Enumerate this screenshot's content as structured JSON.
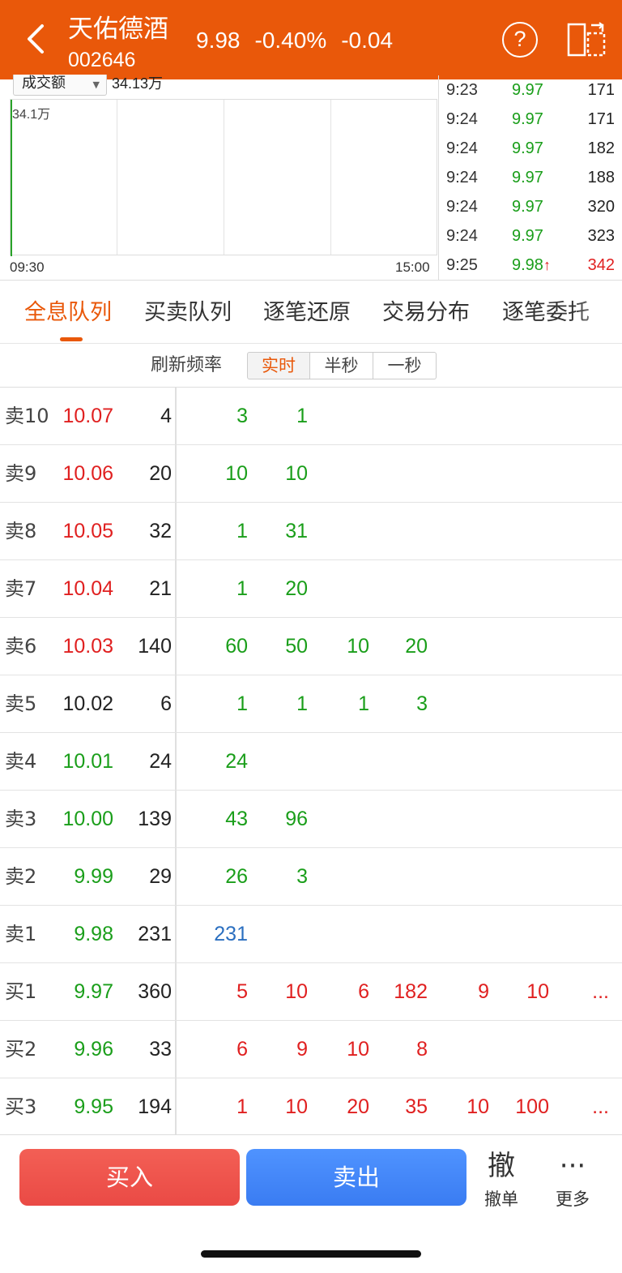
{
  "header": {
    "stock_name": "天佑德酒",
    "stock_code": "002646",
    "price": "9.98",
    "change_pct": "-0.40%",
    "change_amt": "-0.04",
    "help_icon": "?",
    "background_color": "#E9580A"
  },
  "chart": {
    "metric_selector": "成交额",
    "metric_value": "34.13万",
    "y_max_label": "34.1万",
    "x_start": "09:30",
    "x_end": "15:00"
  },
  "chart_data": {
    "type": "bar",
    "categories": [
      "09:30"
    ],
    "values": [
      34.1
    ],
    "title": "",
    "xlabel": "",
    "ylabel": "",
    "ylim": [
      0,
      34.1
    ],
    "xlim_labels": [
      "09:30",
      "15:00"
    ],
    "grid": true
  },
  "ticks": [
    {
      "time": "9:23",
      "price": "9.97",
      "up_arrow": "",
      "volume": "171",
      "volume_color": "black"
    },
    {
      "time": "9:24",
      "price": "9.97",
      "up_arrow": "",
      "volume": "171",
      "volume_color": "black"
    },
    {
      "time": "9:24",
      "price": "9.97",
      "up_arrow": "",
      "volume": "182",
      "volume_color": "black"
    },
    {
      "time": "9:24",
      "price": "9.97",
      "up_arrow": "",
      "volume": "188",
      "volume_color": "black"
    },
    {
      "time": "9:24",
      "price": "9.97",
      "up_arrow": "",
      "volume": "320",
      "volume_color": "black"
    },
    {
      "time": "9:24",
      "price": "9.97",
      "up_arrow": "",
      "volume": "323",
      "volume_color": "black"
    },
    {
      "time": "9:25",
      "price": "9.98",
      "up_arrow": "↑",
      "volume": "342",
      "volume_color": "red"
    }
  ],
  "tabs": [
    {
      "label": "全息队列",
      "active": true
    },
    {
      "label": "买卖队列",
      "active": false
    },
    {
      "label": "逐笔还原",
      "active": false
    },
    {
      "label": "交易分布",
      "active": false
    },
    {
      "label": "逐笔委托",
      "active": false
    }
  ],
  "refresh": {
    "label": "刷新频率",
    "options": [
      {
        "label": "实时",
        "active": true
      },
      {
        "label": "半秒",
        "active": false
      },
      {
        "label": "一秒",
        "active": false
      }
    ]
  },
  "order_book": [
    {
      "label": "卖10",
      "price": "10.07",
      "price_color": "red",
      "total": "4",
      "qty_color": "green",
      "queue": [
        "3",
        "1"
      ]
    },
    {
      "label": "卖9",
      "price": "10.06",
      "price_color": "red",
      "total": "20",
      "qty_color": "green",
      "queue": [
        "10",
        "10"
      ]
    },
    {
      "label": "卖8",
      "price": "10.05",
      "price_color": "red",
      "total": "32",
      "qty_color": "green",
      "queue": [
        "1",
        "31"
      ]
    },
    {
      "label": "卖7",
      "price": "10.04",
      "price_color": "red",
      "total": "21",
      "qty_color": "green",
      "queue": [
        "1",
        "20"
      ]
    },
    {
      "label": "卖6",
      "price": "10.03",
      "price_color": "red",
      "total": "140",
      "qty_color": "green",
      "queue": [
        "60",
        "50",
        "10",
        "20"
      ]
    },
    {
      "label": "卖5",
      "price": "10.02",
      "price_color": "black",
      "total": "6",
      "qty_color": "green",
      "queue": [
        "1",
        "1",
        "1",
        "3"
      ]
    },
    {
      "label": "卖4",
      "price": "10.01",
      "price_color": "green",
      "total": "24",
      "qty_color": "green",
      "queue": [
        "24"
      ]
    },
    {
      "label": "卖3",
      "price": "10.00",
      "price_color": "green",
      "total": "139",
      "qty_color": "green",
      "queue": [
        "43",
        "96"
      ]
    },
    {
      "label": "卖2",
      "price": "9.99",
      "price_color": "green",
      "total": "29",
      "qty_color": "green",
      "queue": [
        "26",
        "3"
      ]
    },
    {
      "label": "卖1",
      "price": "9.98",
      "price_color": "green",
      "total": "231",
      "qty_color": "blue",
      "queue": [
        "231"
      ]
    },
    {
      "label": "买1",
      "price": "9.97",
      "price_color": "green",
      "total": "360",
      "qty_color": "red",
      "queue": [
        "5",
        "10",
        "6",
        "182",
        "9",
        "10",
        "..."
      ]
    },
    {
      "label": "买2",
      "price": "9.96",
      "price_color": "green",
      "total": "33",
      "qty_color": "red",
      "queue": [
        "6",
        "9",
        "10",
        "8"
      ]
    },
    {
      "label": "买3",
      "price": "9.95",
      "price_color": "green",
      "total": "194",
      "qty_color": "red",
      "queue": [
        "1",
        "10",
        "20",
        "35",
        "10",
        "100",
        "..."
      ]
    }
  ],
  "bottom_bar": {
    "buy_label": "买入",
    "sell_label": "卖出",
    "cancel_icon": "撤",
    "cancel_label": "撤单",
    "more_icon": "···",
    "more_label": "更多"
  }
}
